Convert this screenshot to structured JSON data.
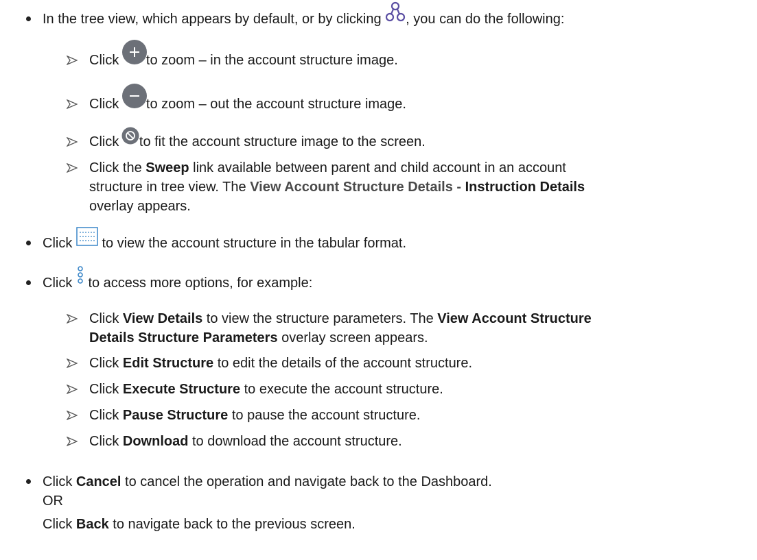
{
  "intro": {
    "before_icon": "In the tree view, which appears by default, or by clicking ",
    "after_icon": ", you can do the following:"
  },
  "zoom_in": {
    "click": "Click ",
    "text": "to zoom – in the account structure image."
  },
  "zoom_out": {
    "click": "Click ",
    "text": "to zoom – out the account structure image."
  },
  "fit": {
    "click": "Click ",
    "text": "to fit the account structure image to the screen."
  },
  "sweep": {
    "l1_a": "Click the ",
    "l1_b": "Sweep",
    "l1_c": " link available between parent and child account in an account",
    "l2_a": "structure in tree view. The ",
    "l2_b": "View Account Structure Details - ",
    "l2_c": "Instruction Details",
    "l3": "overlay appears."
  },
  "tabular": {
    "click": "Click ",
    "text": " to view the account structure in the tabular format."
  },
  "more": {
    "click": "Click ",
    "text": "  to access more options, for example:"
  },
  "view_details": {
    "l1_a": "Click ",
    "l1_b": "View Details",
    "l1_c": " to view the structure parameters. The ",
    "l1_d": "View Account Structure",
    "l2_a": "Details Structure Parameters",
    "l2_b": " overlay screen appears."
  },
  "edit": {
    "a": "Click ",
    "b": "Edit Structure",
    "c": " to edit the details of the account structure."
  },
  "execute": {
    "a": "Click ",
    "b": "Execute Structure",
    "c": " to execute the account structure."
  },
  "pause": {
    "a": "Click ",
    "b": "Pause Structure",
    "c": " to pause the account structure."
  },
  "download": {
    "a": "Click ",
    "b": "Download",
    "c": " to download the account structure."
  },
  "cancel": {
    "l1_a": "Click ",
    "l1_b": "Cancel",
    "l1_c": " to cancel the operation and navigate back to the Dashboard.",
    "or": "OR",
    "l3_a": "Click ",
    "l3_b": "Back",
    "l3_c": " to navigate back to the previous screen."
  },
  "colors": {
    "text": "#1a1a1a",
    "tree_icon": "#5b4fa3",
    "round_icon": "#6c7078",
    "grid_icon": "#3a86c8"
  },
  "icons": [
    "tree-view-icon",
    "zoom-in-icon",
    "zoom-out-icon",
    "fit-screen-icon",
    "table-view-icon",
    "more-options-icon"
  ]
}
